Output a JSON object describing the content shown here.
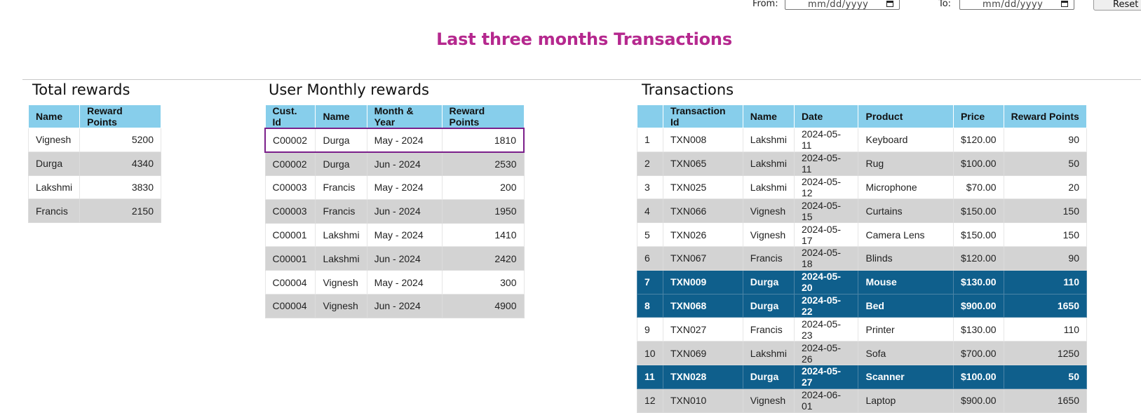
{
  "filters": {
    "from_label": "From:",
    "from_placeholder": "mm/dd/yyyy",
    "to_label": "To:",
    "to_placeholder": "mm/dd/yyyy",
    "reset_label": "Reset"
  },
  "page_title": "Last three months Transactions",
  "total_rewards": {
    "title": "Total rewards",
    "headers": [
      "Name",
      "Reward Points"
    ],
    "rows": [
      [
        "Vignesh",
        "5200"
      ],
      [
        "Durga",
        "4340"
      ],
      [
        "Lakshmi",
        "3830"
      ],
      [
        "Francis",
        "2150"
      ]
    ]
  },
  "monthly_rewards": {
    "title": "User Monthly rewards",
    "headers": [
      "Cust. Id",
      "Name",
      "Month & Year",
      "Reward Points"
    ],
    "rows": [
      [
        "C00002",
        "Durga",
        "May - 2024",
        "1810"
      ],
      [
        "C00002",
        "Durga",
        "Jun - 2024",
        "2530"
      ],
      [
        "C00003",
        "Francis",
        "May - 2024",
        "200"
      ],
      [
        "C00003",
        "Francis",
        "Jun - 2024",
        "1950"
      ],
      [
        "C00001",
        "Lakshmi",
        "May - 2024",
        "1410"
      ],
      [
        "C00001",
        "Lakshmi",
        "Jun - 2024",
        "2420"
      ],
      [
        "C00004",
        "Vignesh",
        "May - 2024",
        "300"
      ],
      [
        "C00004",
        "Vignesh",
        "Jun - 2024",
        "4900"
      ]
    ]
  },
  "transactions": {
    "title": "Transactions",
    "headers": [
      "",
      "Transaction Id",
      "Name",
      "Date",
      "Product",
      "Price",
      "Reward Points"
    ],
    "rows": [
      [
        "1",
        "TXN008",
        "Lakshmi",
        "2024-05-11",
        "Keyboard",
        "$120.00",
        "90"
      ],
      [
        "2",
        "TXN065",
        "Lakshmi",
        "2024-05-11",
        "Rug",
        "$100.00",
        "50"
      ],
      [
        "3",
        "TXN025",
        "Lakshmi",
        "2024-05-12",
        "Microphone",
        "$70.00",
        "20"
      ],
      [
        "4",
        "TXN066",
        "Vignesh",
        "2024-05-15",
        "Curtains",
        "$150.00",
        "150"
      ],
      [
        "5",
        "TXN026",
        "Vignesh",
        "2024-05-17",
        "Camera Lens",
        "$150.00",
        "150"
      ],
      [
        "6",
        "TXN067",
        "Francis",
        "2024-05-18",
        "Blinds",
        "$120.00",
        "90"
      ],
      [
        "7",
        "TXN009",
        "Durga",
        "2024-05-20",
        "Mouse",
        "$130.00",
        "110"
      ],
      [
        "8",
        "TXN068",
        "Durga",
        "2024-05-22",
        "Bed",
        "$900.00",
        "1650"
      ],
      [
        "9",
        "TXN027",
        "Francis",
        "2024-05-23",
        "Printer",
        "$130.00",
        "110"
      ],
      [
        "10",
        "TXN069",
        "Lakshmi",
        "2024-05-26",
        "Sofa",
        "$700.00",
        "1250"
      ],
      [
        "11",
        "TXN028",
        "Durga",
        "2024-05-27",
        "Scanner",
        "$100.00",
        "50"
      ],
      [
        "12",
        "TXN010",
        "Vignesh",
        "2024-06-01",
        "Laptop",
        "$900.00",
        "1650"
      ]
    ]
  },
  "colors": {
    "title": "#b5288e",
    "header_bg": "#87ceeb",
    "stripe_bg": "#d3d3d3",
    "highlight_bg": "#0f5f8c",
    "selected_border": "#7b1f8a"
  }
}
